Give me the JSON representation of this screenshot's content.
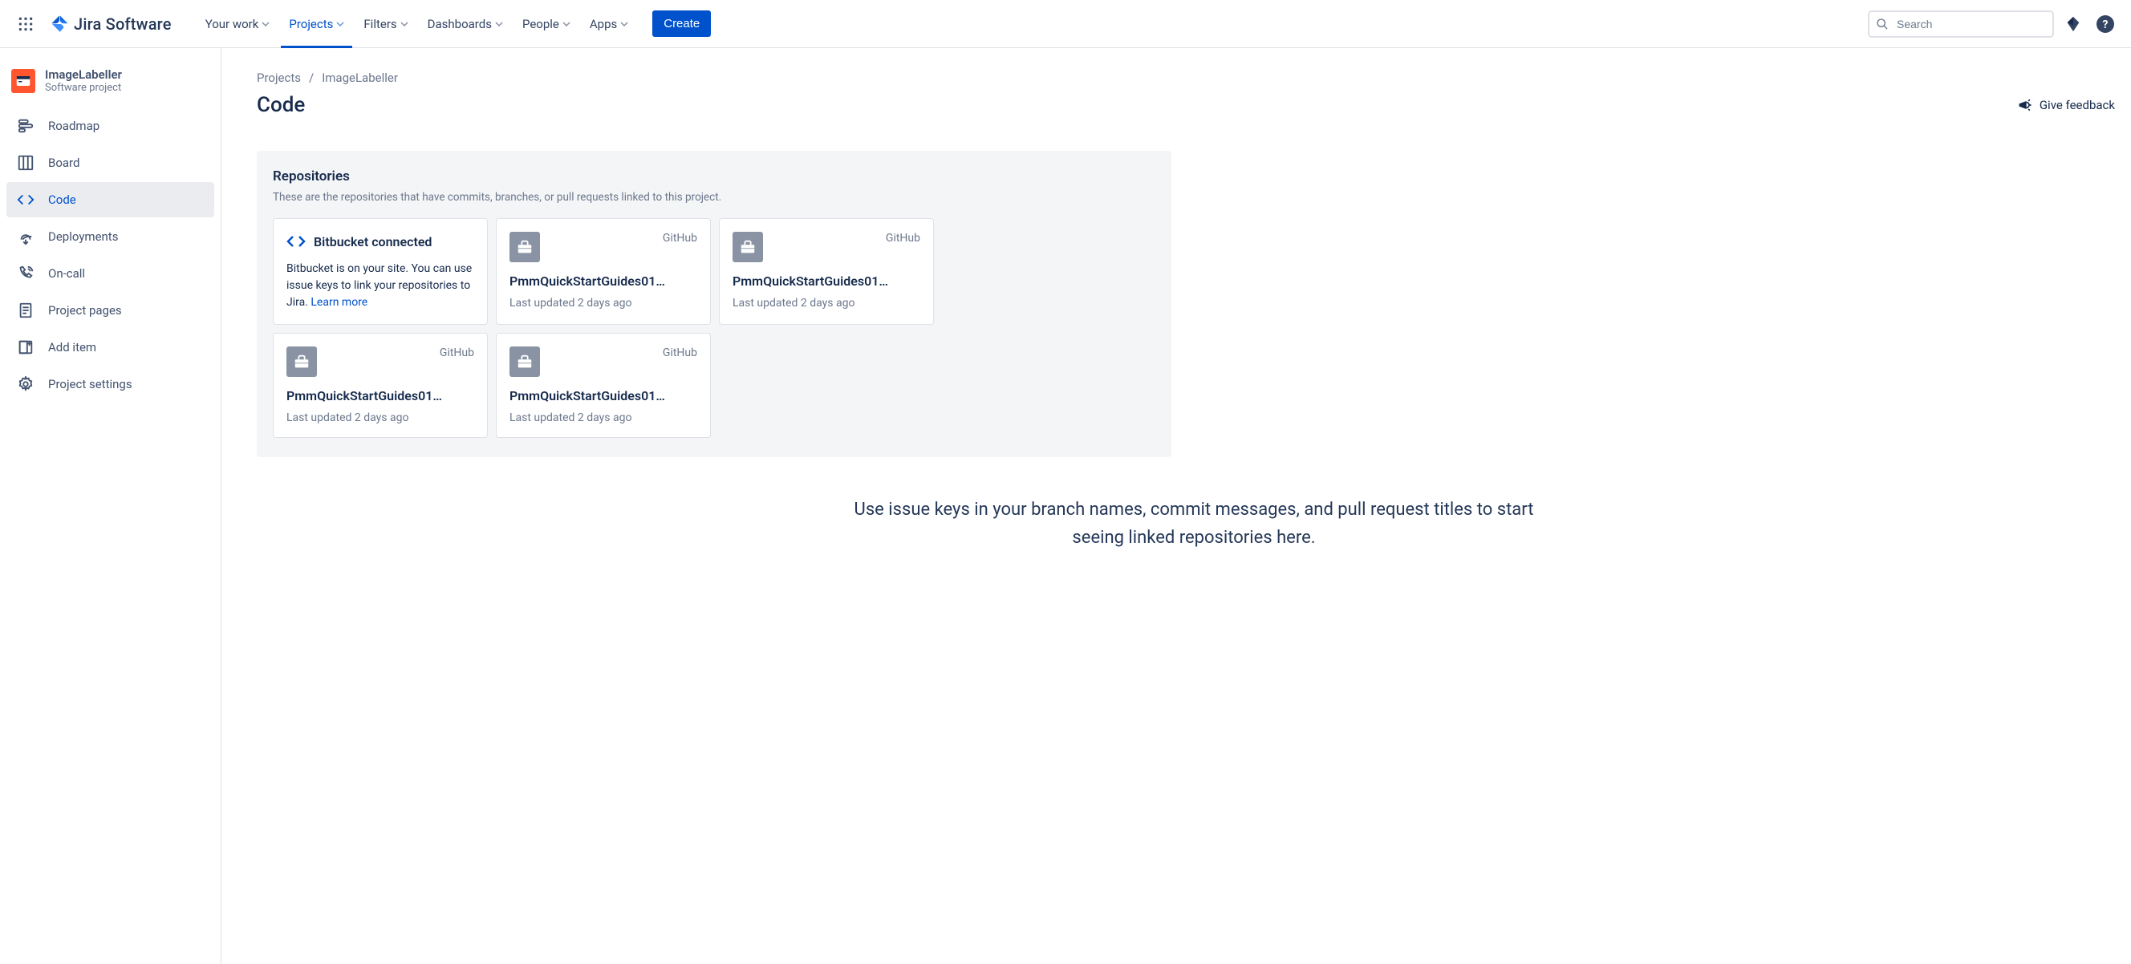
{
  "topnav": {
    "product": "Jira Software",
    "items": [
      {
        "label": "Your work",
        "active": false
      },
      {
        "label": "Projects",
        "active": true
      },
      {
        "label": "Filters",
        "active": false
      },
      {
        "label": "Dashboards",
        "active": false
      },
      {
        "label": "People",
        "active": false
      },
      {
        "label": "Apps",
        "active": false
      }
    ],
    "create": "Create",
    "search_placeholder": "Search"
  },
  "sidebar": {
    "project": {
      "name": "ImageLabeller",
      "type": "Software project"
    },
    "items": [
      {
        "label": "Roadmap"
      },
      {
        "label": "Board"
      },
      {
        "label": "Code"
      },
      {
        "label": "Deployments"
      },
      {
        "label": "On-call"
      },
      {
        "label": "Project pages"
      },
      {
        "label": "Add item"
      },
      {
        "label": "Project settings"
      }
    ]
  },
  "breadcrumb": {
    "root": "Projects",
    "project": "ImageLabeller"
  },
  "page": {
    "title": "Code",
    "feedback": "Give feedback"
  },
  "repositories": {
    "heading": "Repositories",
    "sub": "These are the repositories that have commits, branches, or pull requests linked to this project.",
    "bitbucket": {
      "title": "Bitbucket connected",
      "body": "Bitbucket is on your site. You can use issue keys to link your repositories to Jira. ",
      "learn": "Learn more"
    },
    "cards": [
      {
        "provider": "GitHub",
        "name": "PmmQuickStartGuides01…",
        "updated": "Last updated 2 days ago"
      },
      {
        "provider": "GitHub",
        "name": "PmmQuickStartGuides01…",
        "updated": "Last updated 2 days ago"
      },
      {
        "provider": "GitHub",
        "name": "PmmQuickStartGuides01…",
        "updated": "Last updated 2 days ago"
      },
      {
        "provider": "GitHub",
        "name": "PmmQuickStartGuides01…",
        "updated": "Last updated 2 days ago"
      }
    ]
  },
  "empty": "Use issue keys in your branch names, commit messages, and pull request titles to start seeing linked repositories here."
}
